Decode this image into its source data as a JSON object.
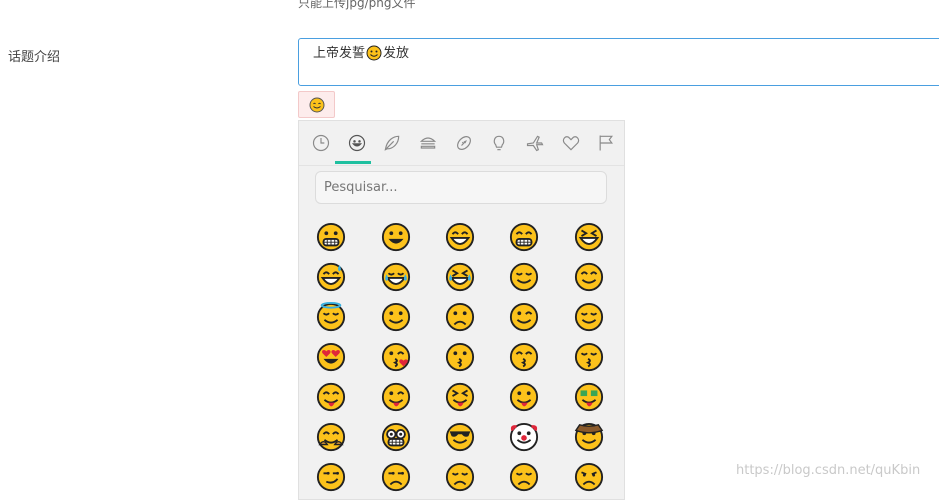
{
  "form": {
    "upload_hint": "只能上传jpg/png文件",
    "topic_label": "话题介绍",
    "topic_text_before": "上帝发誓",
    "topic_text_after": "发放"
  },
  "picker": {
    "search_placeholder": "Pesquisar...",
    "categories": [
      "recent",
      "smileys",
      "nature",
      "food",
      "activities",
      "objects",
      "travel",
      "symbols",
      "flags"
    ],
    "active_category": "smileys",
    "emojis": [
      "grimacing",
      "grinning",
      "smile",
      "beaming",
      "squinting",
      "sweat-smile",
      "joy",
      "rofl",
      "relieved",
      "blush",
      "innocent",
      "slight-smile",
      "upside-down",
      "wink",
      "relieved-2",
      "heart-eyes",
      "kissing-heart",
      "kissing",
      "kissing-smiling",
      "kissing-closed",
      "yum",
      "stuck-out-tongue-wink",
      "stuck-out-tongue-closed",
      "stuck-out-tongue",
      "money-mouth",
      "hugging",
      "nerd",
      "sunglasses",
      "clown",
      "cowboy",
      "smirk",
      "unamused",
      "disappointed",
      "pensive",
      "worried"
    ]
  },
  "watermark": "https://blog.csdn.net/quKbin",
  "colors": {
    "accent": "#1fc0a0",
    "input_border": "#4a9fe0",
    "emoji_face": "#fcc21b"
  }
}
